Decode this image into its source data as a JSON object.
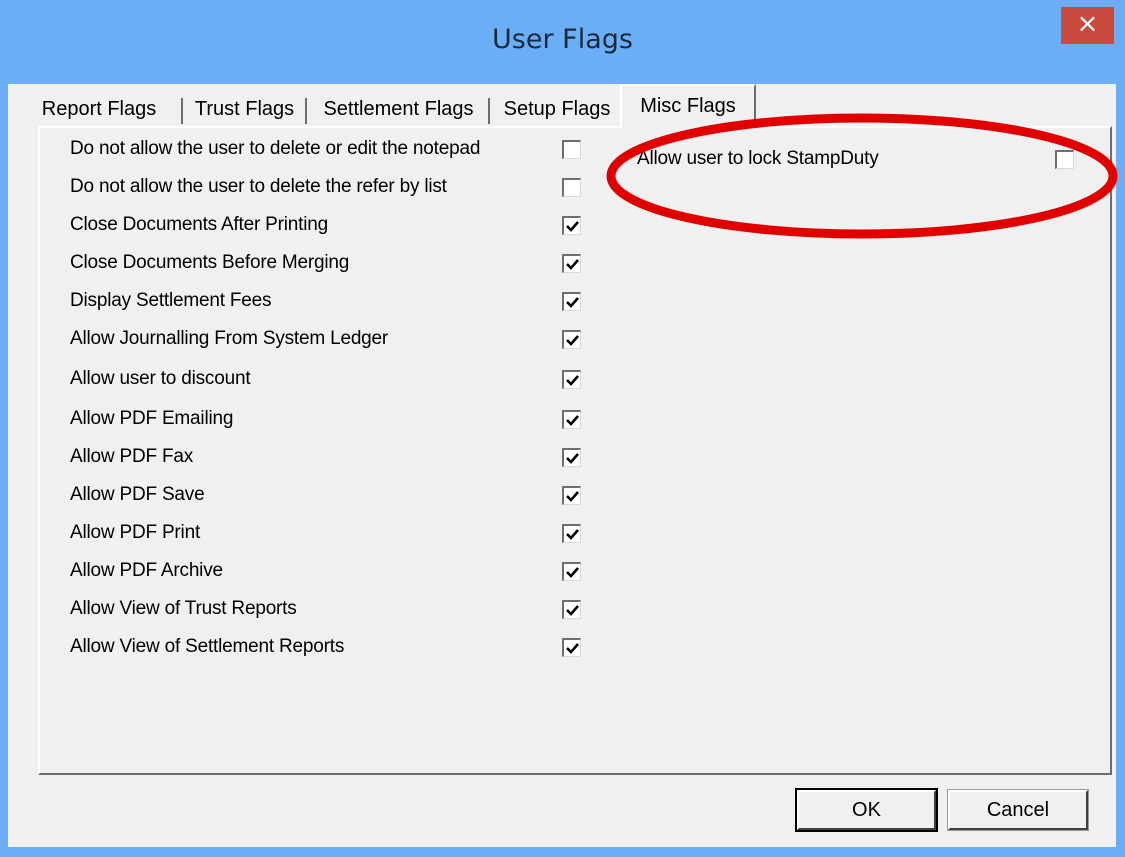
{
  "window": {
    "title": "User Flags"
  },
  "tabs": [
    {
      "label": "Report Flags"
    },
    {
      "label": "Trust Flags"
    },
    {
      "label": "Settlement Flags"
    },
    {
      "label": "Setup Flags"
    },
    {
      "label": "Misc Flags",
      "active": true
    }
  ],
  "left_flags": [
    {
      "label": "Do not allow the user to delete or edit the notepad",
      "checked": false
    },
    {
      "label": "Do not allow the user to delete the refer by list",
      "checked": false
    },
    {
      "label": "Close Documents After Printing",
      "checked": true
    },
    {
      "label": "Close Documents Before Merging",
      "checked": true
    },
    {
      "label": "Display Settlement Fees",
      "checked": true
    },
    {
      "label": "Allow Journalling From System Ledger",
      "checked": true
    },
    {
      "label": "Allow user to discount",
      "checked": true
    },
    {
      "label": "Allow PDF Emailing",
      "checked": true
    },
    {
      "label": "Allow PDF Fax",
      "checked": true
    },
    {
      "label": "Allow PDF Save",
      "checked": true
    },
    {
      "label": "Allow PDF Print",
      "checked": true
    },
    {
      "label": "Allow PDF Archive",
      "checked": true
    },
    {
      "label": "Allow View of Trust Reports",
      "checked": true
    },
    {
      "label": "Allow View of Settlement Reports",
      "checked": true
    }
  ],
  "right_flags": [
    {
      "label": "Allow user to lock StampDuty",
      "checked": false
    }
  ],
  "buttons": {
    "ok": "OK",
    "cancel": "Cancel"
  },
  "close_glyph": "×",
  "annotation_color": "#e00000"
}
